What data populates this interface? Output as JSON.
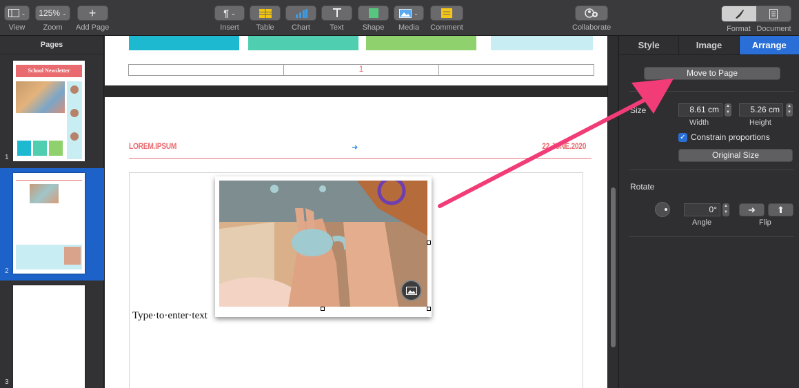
{
  "toolbar": {
    "view_label": "View",
    "zoom_value": "125%",
    "zoom_label": "Zoom",
    "add_page_label": "Add Page",
    "insert_label": "Insert",
    "table_label": "Table",
    "chart_label": "Chart",
    "text_label": "Text",
    "shape_label": "Shape",
    "media_label": "Media",
    "comment_label": "Comment",
    "collaborate_label": "Collaborate",
    "format_label": "Format",
    "document_label": "Document"
  },
  "sidebar": {
    "title": "Pages",
    "pages": [
      {
        "number": "1",
        "newsletter_title": "School Newsletter"
      },
      {
        "number": "2"
      },
      {
        "number": "3"
      }
    ]
  },
  "document": {
    "table_cell_number": "1",
    "header_left": "LOREM.IPSUM",
    "header_right": "22 JUNE.2020",
    "body_placeholder": "Type·to·enter·text"
  },
  "inspector": {
    "tabs": [
      "Style",
      "Image",
      "Arrange"
    ],
    "active_tab": "Arrange",
    "move_to_page": "Move to Page",
    "size_heading": "Size",
    "width_value": "8.61 cm",
    "width_label": "Width",
    "height_value": "5.26 cm",
    "height_label": "Height",
    "constrain_label": "Constrain proportions",
    "constrain_checked": true,
    "original_size": "Original Size",
    "rotate_heading": "Rotate",
    "angle_value": "0°",
    "angle_label": "Angle",
    "flip_label": "Flip"
  },
  "colors": {
    "accent": "#2a6fd8",
    "annotation_arrow": "#f23c78",
    "header_red": "#ea6b6f",
    "teal": "#1cb9d0",
    "mint": "#4fcfb0",
    "green": "#8fd26d",
    "light_blue": "#c8edf3"
  }
}
